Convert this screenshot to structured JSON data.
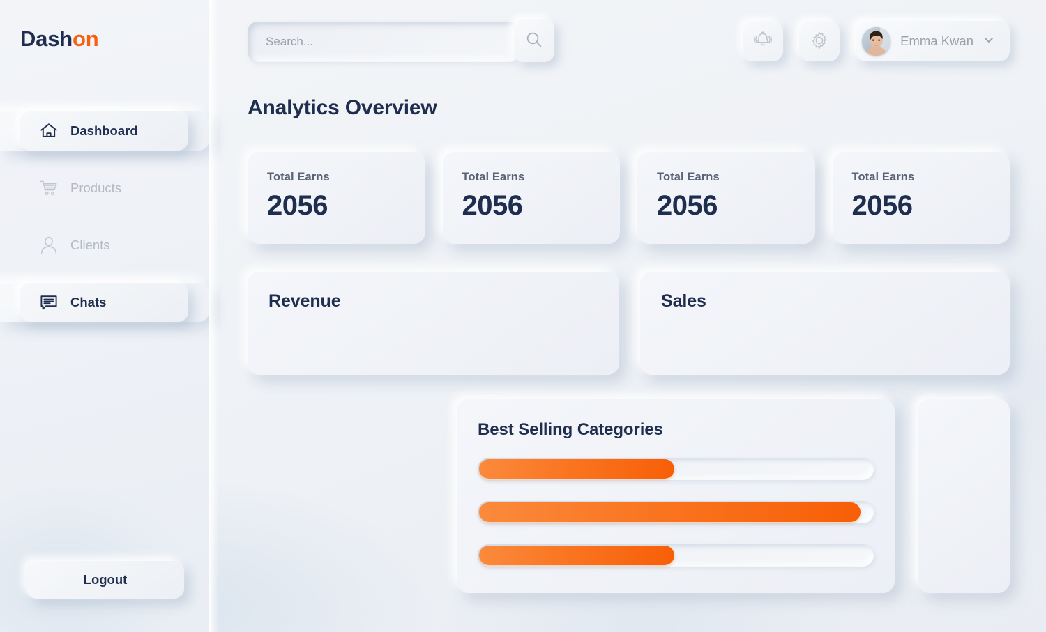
{
  "brand": {
    "name_dark": "Dash",
    "name_accent": "on",
    "accent_color": "#f75f12",
    "dark_color": "#1f2d4f"
  },
  "sidebar": {
    "items": [
      {
        "label": "Dashboard",
        "icon": "home-icon",
        "active": true
      },
      {
        "label": "Products",
        "icon": "cart-icon",
        "active": false
      },
      {
        "label": "Clients",
        "icon": "user-icon",
        "active": false
      },
      {
        "label": "Chats",
        "icon": "chat-icon",
        "active": true
      }
    ],
    "logout_label": "Logout"
  },
  "header": {
    "search": {
      "value": "",
      "placeholder": "Search...",
      "button_icon": "search-icon"
    },
    "notifications_icon": "bell-icon",
    "settings_icon": "gear-icon",
    "user": {
      "name": "Emma Kwan",
      "avatar_icon": "avatar",
      "chevron_icon": "chevron-down-icon"
    }
  },
  "main": {
    "page_title": "Analytics Overview",
    "stat_cards": [
      {
        "label": "Total Earns",
        "value": "2056"
      },
      {
        "label": "Total Earns",
        "value": "2056"
      },
      {
        "label": "Total Earns",
        "value": "2056"
      },
      {
        "label": "Total Earns",
        "value": "2056"
      }
    ],
    "panels": [
      {
        "title": "Revenue"
      },
      {
        "title": "Sales"
      }
    ],
    "categories": {
      "title": "Best Selling Categories",
      "bars": [
        {
          "percent": 50
        },
        {
          "percent": 97
        },
        {
          "percent": 50
        }
      ],
      "bar_color_start": "#fb8a3c",
      "bar_color_end": "#f75f07"
    }
  },
  "chart_data": {
    "type": "bar",
    "title": "Best Selling Categories",
    "orientation": "horizontal",
    "categories": [
      "",
      "",
      ""
    ],
    "values": [
      50,
      97,
      50
    ],
    "xlabel": "",
    "ylabel": "",
    "xlim": [
      0,
      100
    ],
    "grid": false,
    "legend": false
  }
}
